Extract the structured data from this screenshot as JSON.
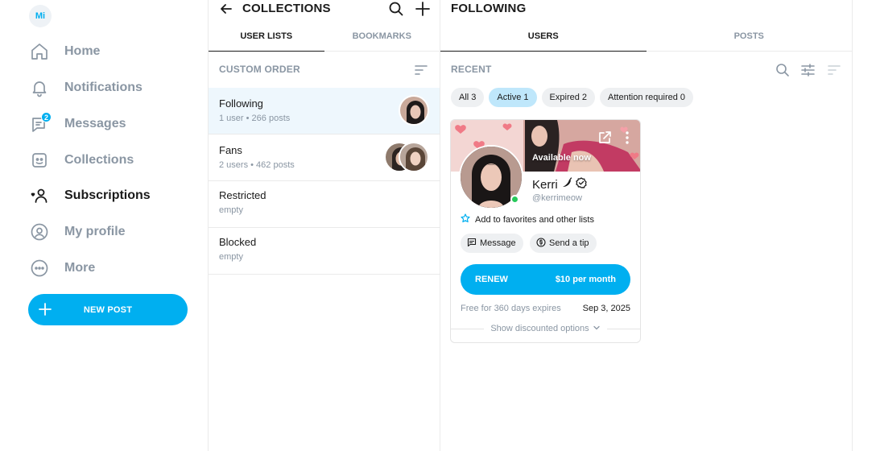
{
  "user": {
    "initials": "Mi"
  },
  "nav": {
    "items": [
      {
        "label": "Home",
        "icon": "home-icon"
      },
      {
        "label": "Notifications",
        "icon": "bell-icon"
      },
      {
        "label": "Messages",
        "icon": "chat-icon",
        "badge": "2"
      },
      {
        "label": "Collections",
        "icon": "collections-icon"
      },
      {
        "label": "Subscriptions",
        "icon": "subscriptions-icon",
        "active": true
      },
      {
        "label": "My profile",
        "icon": "profile-icon"
      },
      {
        "label": "More",
        "icon": "more-icon"
      }
    ],
    "new_post_label": "NEW POST"
  },
  "collections": {
    "title": "COLLECTIONS",
    "tabs": [
      {
        "label": "USER LISTS",
        "active": true
      },
      {
        "label": "BOOKMARKS",
        "active": false
      }
    ],
    "order_label": "CUSTOM ORDER",
    "lists": [
      {
        "name": "Following",
        "meta_left": "1 user",
        "meta_right": "266 posts",
        "selected": true
      },
      {
        "name": "Fans",
        "meta_left": "2 users",
        "meta_right": "462 posts",
        "selected": false
      },
      {
        "name": "Restricted",
        "meta_left": "empty",
        "meta_right": "",
        "selected": false
      },
      {
        "name": "Blocked",
        "meta_left": "empty",
        "meta_right": "",
        "selected": false
      }
    ]
  },
  "following": {
    "title": "FOLLOWING",
    "tabs": [
      {
        "label": "USERS",
        "active": true
      },
      {
        "label": "POSTS",
        "active": false
      }
    ],
    "recent_label": "RECENT",
    "chips": [
      {
        "label": "All 3",
        "active": false
      },
      {
        "label": "Active 1",
        "active": true
      },
      {
        "label": "Expired 2",
        "active": false
      },
      {
        "label": "Attention required 0",
        "active": false
      }
    ],
    "card": {
      "banner_text": "Available now",
      "name": "Kerri",
      "handle": "@kerrimeow",
      "favorites_label": "Add to favorites and other lists",
      "message_label": "Message",
      "tip_label": "Send a tip",
      "renew_label": "RENEW",
      "price_label": "$10 per month",
      "free_text": "Free for 360 days expires",
      "expires_date": "Sep 3, 2025",
      "discount_label": "Show discounted options",
      "online_color": "#27c95b"
    }
  },
  "colors": {
    "accent": "#00aff0",
    "muted": "#8a96a3",
    "selected_row": "#eef7fd",
    "chip_active": "#bfe7fb"
  }
}
